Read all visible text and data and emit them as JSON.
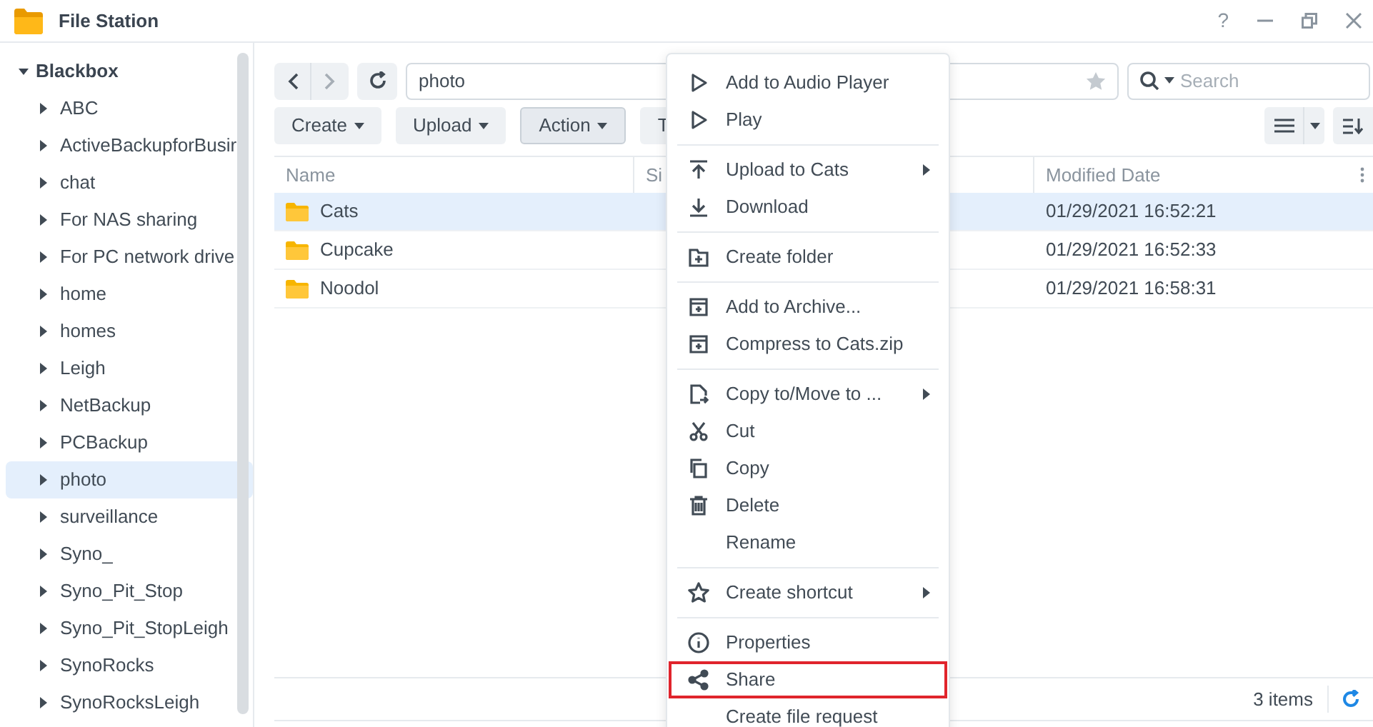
{
  "window": {
    "title": "File Station",
    "help": "?"
  },
  "sidebar": {
    "root": {
      "label": "Blackbox",
      "expanded": true,
      "children": [
        {
          "label": "ABC",
          "selected": false
        },
        {
          "label": "ActiveBackupforBusir",
          "selected": false
        },
        {
          "label": "chat",
          "selected": false
        },
        {
          "label": "For NAS sharing",
          "selected": false
        },
        {
          "label": "For PC network drive",
          "selected": false
        },
        {
          "label": "home",
          "selected": false
        },
        {
          "label": "homes",
          "selected": false
        },
        {
          "label": "Leigh",
          "selected": false
        },
        {
          "label": "NetBackup",
          "selected": false
        },
        {
          "label": "PCBackup",
          "selected": false
        },
        {
          "label": "photo",
          "selected": true
        },
        {
          "label": "surveillance",
          "selected": false
        },
        {
          "label": "Syno_",
          "selected": false
        },
        {
          "label": "Syno_Pit_Stop",
          "selected": false
        },
        {
          "label": "Syno_Pit_StopLeigh",
          "selected": false
        },
        {
          "label": "SynoRocks",
          "selected": false
        },
        {
          "label": "SynoRocksLeigh",
          "selected": false
        }
      ]
    }
  },
  "path": {
    "value": "photo"
  },
  "search": {
    "placeholder": "Search"
  },
  "toolbar": [
    {
      "label": "Create",
      "selected": false
    },
    {
      "label": "Upload",
      "selected": false
    },
    {
      "label": "Action",
      "selected": true
    },
    {
      "label": "T",
      "selected": false
    }
  ],
  "table": {
    "columns": [
      "Name",
      "Si",
      "Modified Date"
    ],
    "rows": [
      {
        "name": "Cats",
        "modified": "01/29/2021 16:52:21",
        "selected": true
      },
      {
        "name": "Cupcake",
        "modified": "01/29/2021 16:52:33",
        "selected": false
      },
      {
        "name": "Noodol",
        "modified": "01/29/2021 16:58:31",
        "selected": false
      }
    ]
  },
  "status_bar": {
    "count": "3 items"
  },
  "context_menu": [
    [
      {
        "label": "Add to Audio Player",
        "submenu": false,
        "highlighted": false
      },
      {
        "label": "Play",
        "submenu": false,
        "highlighted": false
      }
    ],
    [
      {
        "label": "Upload to Cats",
        "submenu": true,
        "highlighted": false
      },
      {
        "label": "Download",
        "submenu": false,
        "highlighted": false
      }
    ],
    [
      {
        "label": "Create folder",
        "submenu": false,
        "highlighted": false
      }
    ],
    [
      {
        "label": "Add to Archive...",
        "submenu": false,
        "highlighted": false
      },
      {
        "label": "Compress to Cats.zip",
        "submenu": false,
        "highlighted": false
      }
    ],
    [
      {
        "label": "Copy to/Move to ...",
        "submenu": true,
        "highlighted": false
      },
      {
        "label": "Cut",
        "submenu": false,
        "highlighted": false
      },
      {
        "label": "Copy",
        "submenu": false,
        "highlighted": false
      },
      {
        "label": "Delete",
        "submenu": false,
        "highlighted": false
      },
      {
        "label": "Rename",
        "submenu": false,
        "highlighted": false
      }
    ],
    [
      {
        "label": "Create shortcut",
        "submenu": true,
        "highlighted": false
      }
    ],
    [
      {
        "label": "Properties",
        "submenu": false,
        "highlighted": false
      },
      {
        "label": "Share",
        "submenu": false,
        "highlighted": true
      },
      {
        "label": "Create file request",
        "submenu": false,
        "highlighted": false
      }
    ]
  ]
}
